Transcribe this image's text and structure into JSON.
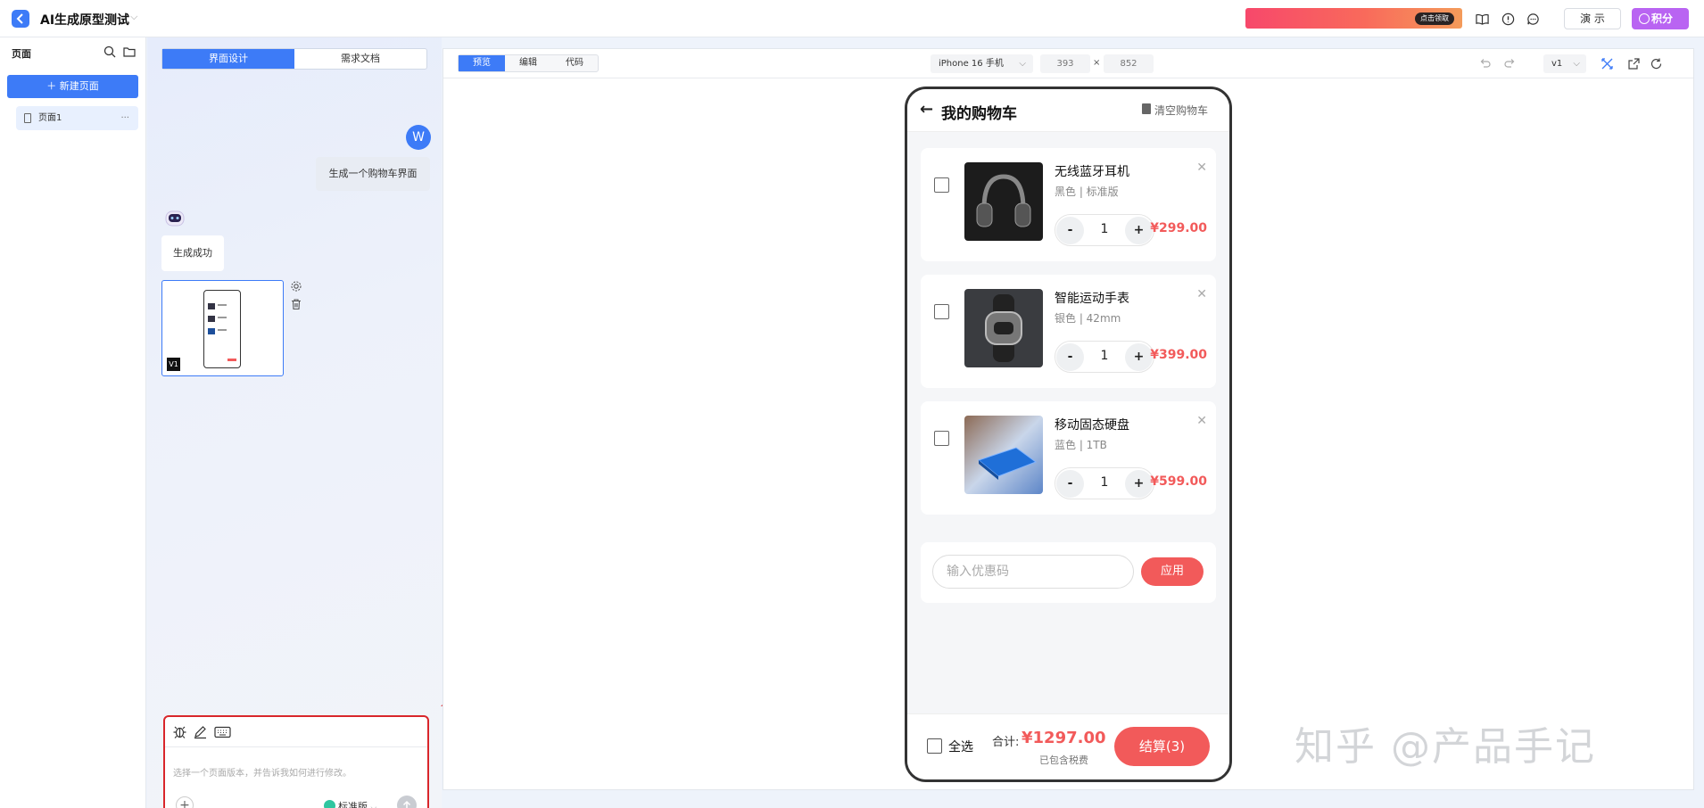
{
  "topbar": {
    "title": "AI生成原型测试",
    "promo_button": "点击领取",
    "demo_label": "演 示",
    "points_label": "积分"
  },
  "pages": {
    "title": "页面",
    "new_page": "新建页面",
    "items": [
      {
        "label": "页面1"
      }
    ],
    "more": "···"
  },
  "chat": {
    "tabs": [
      {
        "label": "界面设计",
        "active": true
      },
      {
        "label": "需求文档",
        "active": false
      }
    ],
    "user_initial": "W",
    "user_message": "生成一个购物车界面",
    "bot_message": "生成成功",
    "thumb_version": "V1",
    "composer": {
      "placeholder": "选择一个页面版本，并告诉我如何进行修改。",
      "model": "标准版"
    }
  },
  "preview": {
    "modes": [
      {
        "label": "预览",
        "active": true
      },
      {
        "label": "编辑",
        "active": false
      },
      {
        "label": "代码",
        "active": false
      }
    ],
    "device": "iPhone 16 手机",
    "width": "393",
    "times": "×",
    "height": "852",
    "version": "v1"
  },
  "phone": {
    "title": "我的购物车",
    "clear": "清空购物车",
    "items": [
      {
        "name": "无线蓝牙耳机",
        "spec": "黑色 | 标准版",
        "qty": "1",
        "price": "¥299.00"
      },
      {
        "name": "智能运动手表",
        "spec": "银色 | 42mm",
        "qty": "1",
        "price": "¥399.00"
      },
      {
        "name": "移动固态硬盘",
        "spec": "蓝色 | 1TB",
        "qty": "1",
        "price": "¥599.00"
      }
    ],
    "coupon_placeholder": "输入优惠码",
    "coupon_apply": "应用",
    "select_all": "全选",
    "total_label": "合计:",
    "total_value": "¥1297.00",
    "tax_note": "已包含税费",
    "checkout": "结算(3)"
  },
  "watermark": "知乎 @产品手记",
  "colors": {
    "primary": "#3d7bf7",
    "accent": "#f25a5a",
    "annotation": "#d9262b",
    "points": "#b964f2"
  }
}
